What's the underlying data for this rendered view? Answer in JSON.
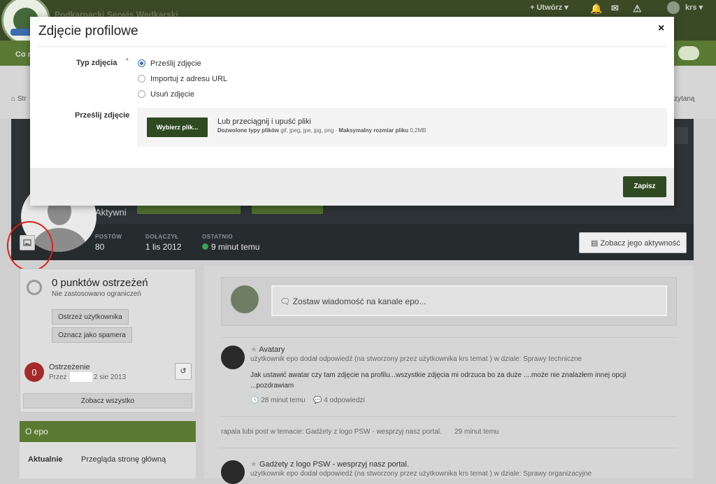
{
  "header": {
    "site_name": "Podkarpacki Serwis Wędkarski",
    "create_label": "+ Utwórz ▾",
    "user_label": "krs ▾"
  },
  "nav": {
    "left_text": "Co n"
  },
  "breadcrumb": {
    "left": "Str",
    "right": "zytaną"
  },
  "profile": {
    "status": "Aktywni",
    "stats": [
      {
        "label": "POSTÓW",
        "value": "80"
      },
      {
        "label": "DOŁĄCZYŁ",
        "value": "1 lis 2012"
      },
      {
        "label": "OSTATNIO",
        "value": "9 minut temu"
      }
    ],
    "activity_button": "Zobacz jego aktywność"
  },
  "warnings": {
    "points": "0 punktów ostrzeżeń",
    "no_restrictions": "Nie zastosowano ograniczeń",
    "warn_button": "Ostrzeż użytkownika",
    "spam_button": "Oznacz jako spamera",
    "badge_count": "0",
    "item_title": "Ostrzeżenie",
    "item_by": "Przez",
    "item_date": "2 sie 2013",
    "see_all": "Zobacz wszystko"
  },
  "about": {
    "title": "O epo",
    "key": "Aktualnie",
    "value": "Przegląda stronę główną"
  },
  "status_placeholder": "Zostaw wiadomość na kanale epo...",
  "feed": [
    {
      "title": "Avatary",
      "meta": "użytkownik epo dodał odpowiedź (na stworzony przez użytkownika krs temat ) w dziale: Sprawy techniczne",
      "text1": "Jak ustawić awatar czy tam zdjęcie na profilu...wszystkie zdjęcia mi odrzuca bo za duże ....może nie znalazłem innej opcji",
      "text2": "...pozdrawiam",
      "time": "28 minut temu",
      "replies": "4 odpowiedzi"
    },
    {
      "line": "rapala lubi post w temacie: Gadżety z logo PSW - wesprzyj nasz portal.",
      "time": "29 minut temu"
    },
    {
      "title": "Gadżety z logo PSW - wesprzyj nasz portal.",
      "meta": "użytkownik epo dodał odpowiedź (na stworzony przez użytkownika krs temat ) w dziale: Sprawy organizacyjne"
    }
  ],
  "modal": {
    "title": "Zdjęcie profilowe",
    "close": "×",
    "type_label": "Typ zdjęcia",
    "required_mark": "*",
    "options": [
      {
        "label": "Prześlij zdjęcie",
        "selected": true
      },
      {
        "label": "Importuj z adresu URL",
        "selected": false
      },
      {
        "label": "Usuń zdjęcie",
        "selected": false
      }
    ],
    "upload_label": "Prześlij zdjęcie",
    "choose_button": "Wybierz plik...",
    "drag_text": "Lub przeciągnij i upuść pliki",
    "allowed_label": "Dozwolone typy plików",
    "allowed_types": "gif, jpeg, jpe, jpg, png",
    "max_size_label": "Maksymalny rozmiar pliku",
    "max_size": "0,2MB",
    "save_button": "Zapisz"
  },
  "colors": {
    "brand_green": "#2f4a20",
    "nav_green": "#5a7a34",
    "radio_accent": "#3a6ea5",
    "annotation_red": "#e0201a"
  }
}
